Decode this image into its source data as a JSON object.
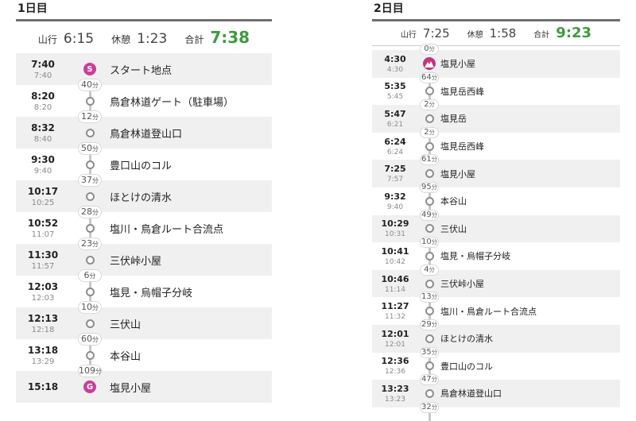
{
  "days": [
    {
      "title": "1日目",
      "summary": {
        "climb_label": "山行",
        "climb": "6:15",
        "rest_label": "休憩",
        "rest": "1:23",
        "total_label": "合計",
        "total": "7:38"
      },
      "unit": "分",
      "stops": [
        {
          "time": "7:40",
          "planned": "7:40",
          "name": "スタート地点",
          "marker": "start",
          "badge": "S"
        },
        {
          "time": "8:20",
          "planned": "8:20",
          "name": "鳥倉林道ゲート（駐車場）",
          "marker": "point"
        },
        {
          "time": "8:32",
          "planned": "8:40",
          "name": "鳥倉林道登山口",
          "marker": "point"
        },
        {
          "time": "9:30",
          "planned": "9:40",
          "name": "豊口山のコル",
          "marker": "point"
        },
        {
          "time": "10:17",
          "planned": "10:25",
          "name": "ほとけの清水",
          "marker": "point"
        },
        {
          "time": "10:52",
          "planned": "11:07",
          "name": "塩川・鳥倉ルート合流点",
          "marker": "point"
        },
        {
          "time": "11:30",
          "planned": "11:57",
          "name": "三伏峠小屋",
          "marker": "point"
        },
        {
          "time": "12:03",
          "planned": "12:03",
          "name": "塩見・烏帽子分岐",
          "marker": "point"
        },
        {
          "time": "12:13",
          "planned": "12:18",
          "name": "三伏山",
          "marker": "point"
        },
        {
          "time": "13:18",
          "planned": "13:29",
          "name": "本谷山",
          "marker": "point"
        },
        {
          "time": "15:18",
          "planned": "",
          "name": "塩見小屋",
          "marker": "goal",
          "badge": "G"
        }
      ],
      "durations": [
        "40",
        "12",
        "50",
        "37",
        "28",
        "23",
        "6",
        "10",
        "60",
        "109"
      ]
    },
    {
      "title": "2日目",
      "summary": {
        "climb_label": "山行",
        "climb": "7:25",
        "rest_label": "休憩",
        "rest": "1:58",
        "total_label": "合計",
        "total": "9:23"
      },
      "unit": "分",
      "lead_duration": "0",
      "stops": [
        {
          "time": "4:30",
          "planned": "4:30",
          "name": "塩見小屋",
          "marker": "hut"
        },
        {
          "time": "5:35",
          "planned": "5:45",
          "name": "塩見岳西峰",
          "marker": "point"
        },
        {
          "time": "5:47",
          "planned": "6:21",
          "name": "塩見岳",
          "marker": "point"
        },
        {
          "time": "6:24",
          "planned": "6:24",
          "name": "塩見岳西峰",
          "marker": "point"
        },
        {
          "time": "7:25",
          "planned": "7:57",
          "name": "塩見小屋",
          "marker": "point"
        },
        {
          "time": "9:32",
          "planned": "9:40",
          "name": "本谷山",
          "marker": "point"
        },
        {
          "time": "10:29",
          "planned": "10:31",
          "name": "三伏山",
          "marker": "point"
        },
        {
          "time": "10:41",
          "planned": "10:42",
          "name": "塩見・烏帽子分岐",
          "marker": "point"
        },
        {
          "time": "10:46",
          "planned": "11:14",
          "name": "三伏峠小屋",
          "marker": "point"
        },
        {
          "time": "11:27",
          "planned": "11:32",
          "name": "塩川・鳥倉ルート合流点",
          "marker": "point"
        },
        {
          "time": "12:01",
          "planned": "12:01",
          "name": "ほとけの清水",
          "marker": "point"
        },
        {
          "time": "12:36",
          "planned": "12:36",
          "name": "豊口山のコル",
          "marker": "point"
        },
        {
          "time": "13:23",
          "planned": "13:23",
          "name": "鳥倉林道登山口",
          "marker": "point"
        }
      ],
      "durations": [
        "64",
        "2",
        "2",
        "61",
        "95",
        "49",
        "10",
        "4",
        "13",
        "29",
        "35",
        "47",
        "32"
      ]
    }
  ]
}
